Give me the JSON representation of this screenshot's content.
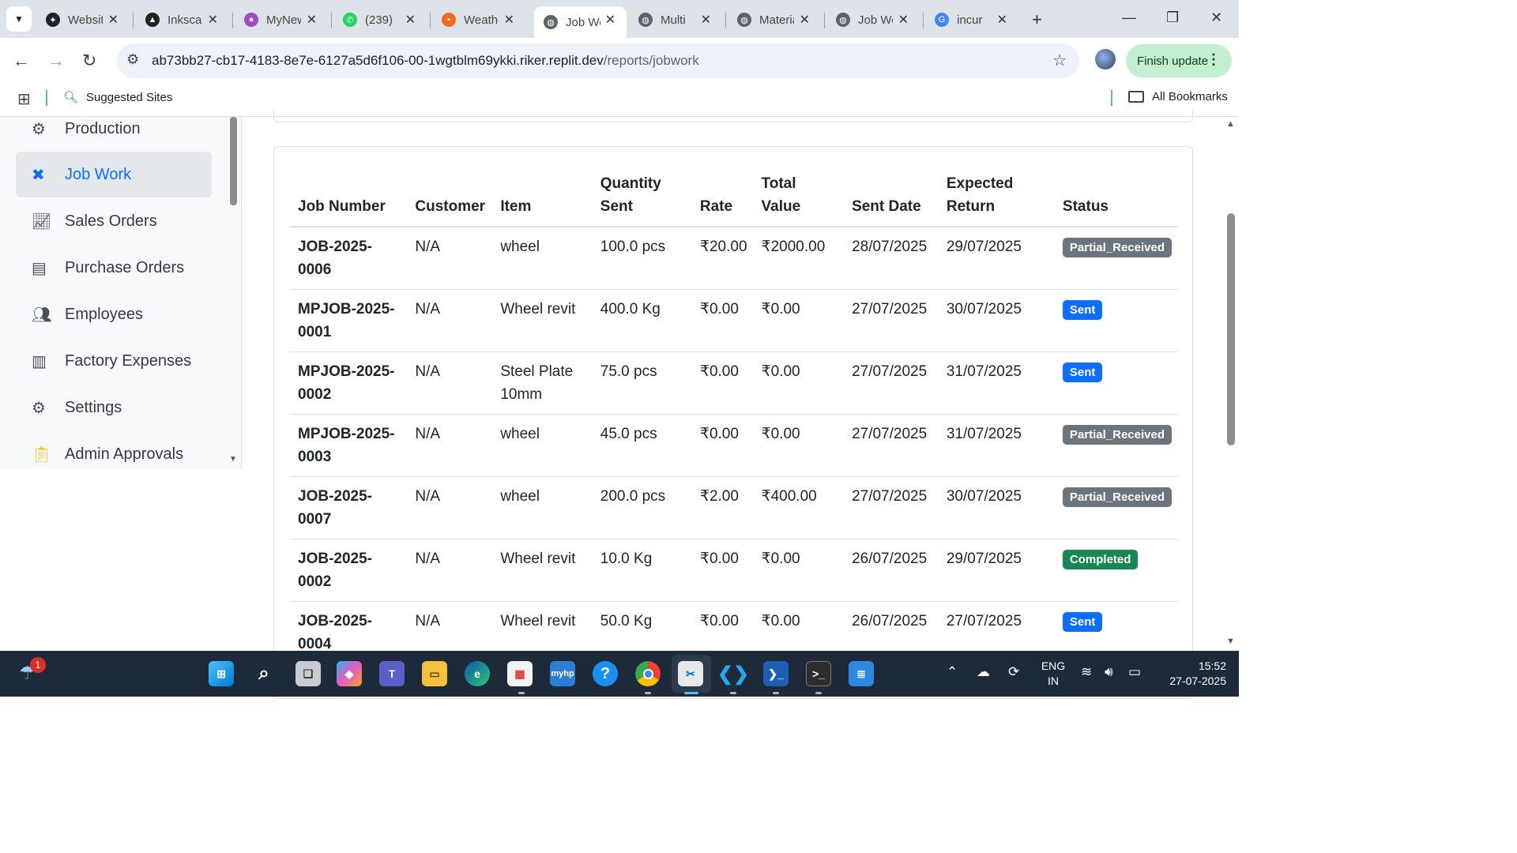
{
  "tabs": [
    {
      "title": "Website",
      "favicon": "openai-icon",
      "color": "#222222"
    },
    {
      "title": "Inkscape",
      "favicon": "inkscape-icon",
      "color": "#222222"
    },
    {
      "title": "MyNew",
      "favicon": "mynew-icon",
      "color": "#a24bc4"
    },
    {
      "title": "(239)",
      "favicon": "whatsapp-icon",
      "color": "#25d366"
    },
    {
      "title": "Weather",
      "favicon": "weather-icon",
      "color": "#f26b1d"
    },
    {
      "title": "Job Work",
      "favicon": "globe-icon",
      "color": "#5f6368"
    },
    {
      "title": "Multi",
      "favicon": "globe-icon",
      "color": "#5f6368"
    },
    {
      "title": "Material",
      "favicon": "globe-icon",
      "color": "#5f6368"
    },
    {
      "title": "Job Work",
      "favicon": "globe-icon",
      "color": "#5f6368"
    },
    {
      "title": "incur",
      "favicon": "google-icon",
      "color": "#4285f4"
    }
  ],
  "active_tab": 5,
  "address_bar": {
    "host": "ab73bb27-cb17-4183-8e7e-6127a5d6f106-00-1wgtblm69ykki.riker.replit.dev",
    "path": "/reports/jobwork"
  },
  "toolbar": {
    "finish_update_label": "Finish update"
  },
  "bookmarks": {
    "suggested": "Suggested Sites",
    "all": "All Bookmarks"
  },
  "sidebar": {
    "items": [
      {
        "label": "Production",
        "icon": "cogs-icon"
      },
      {
        "label": "Job Work",
        "icon": "tools-icon",
        "active": true
      },
      {
        "label": "Sales Orders",
        "icon": "chart-line-icon"
      },
      {
        "label": "Purchase Orders",
        "icon": "file-invoice-icon"
      },
      {
        "label": "Employees",
        "icon": "users-icon"
      },
      {
        "label": "Factory Expenses",
        "icon": "receipt-icon"
      },
      {
        "label": "Settings",
        "icon": "gear-icon"
      },
      {
        "label": "Admin Approvals",
        "icon": "clipboard-check-icon"
      }
    ]
  },
  "table": {
    "headers": [
      "Job Number",
      "Customer",
      "Item",
      "Quantity Sent",
      "Rate",
      "Total Value",
      "Sent Date",
      "Expected Return",
      "Status"
    ],
    "rows": [
      {
        "job": "JOB-2025-0006",
        "customer": "N/A",
        "item": "wheel",
        "qty": "100.0 pcs",
        "rate": "₹20.00",
        "total": "₹2000.00",
        "sent": "28/07/2025",
        "expected": "29/07/2025",
        "status": "Partial_Received"
      },
      {
        "job": "MPJOB-2025-0001",
        "customer": "N/A",
        "item": "Wheel revit",
        "qty": "400.0 Kg",
        "rate": "₹0.00",
        "total": "₹0.00",
        "sent": "27/07/2025",
        "expected": "30/07/2025",
        "status": "Sent"
      },
      {
        "job": "MPJOB-2025-0002",
        "customer": "N/A",
        "item": "Steel Plate 10mm",
        "qty": "75.0 pcs",
        "rate": "₹0.00",
        "total": "₹0.00",
        "sent": "27/07/2025",
        "expected": "31/07/2025",
        "status": "Sent"
      },
      {
        "job": "MPJOB-2025-0003",
        "customer": "N/A",
        "item": "wheel",
        "qty": "45.0 pcs",
        "rate": "₹0.00",
        "total": "₹0.00",
        "sent": "27/07/2025",
        "expected": "31/07/2025",
        "status": "Partial_Received"
      },
      {
        "job": "JOB-2025-0007",
        "customer": "N/A",
        "item": "wheel",
        "qty": "200.0 pcs",
        "rate": "₹2.00",
        "total": "₹400.00",
        "sent": "27/07/2025",
        "expected": "30/07/2025",
        "status": "Partial_Received"
      },
      {
        "job": "JOB-2025-0002",
        "customer": "N/A",
        "item": "Wheel revit",
        "qty": "10.0 Kg",
        "rate": "₹0.00",
        "total": "₹0.00",
        "sent": "26/07/2025",
        "expected": "29/07/2025",
        "status": "Completed"
      },
      {
        "job": "JOB-2025-0004",
        "customer": "N/A",
        "item": "Wheel revit",
        "qty": "50.0 Kg",
        "rate": "₹0.00",
        "total": "₹0.00",
        "sent": "26/07/2025",
        "expected": "27/07/2025",
        "status": "Sent"
      }
    ]
  },
  "status_colors": {
    "Partial_Received": "#6c757d",
    "Sent": "#0d6efd",
    "Completed": "#198754"
  },
  "taskbar": {
    "notification_count": "1",
    "language": "ENG",
    "region": "IN",
    "time": "15:52",
    "date": "27-07-2025"
  }
}
